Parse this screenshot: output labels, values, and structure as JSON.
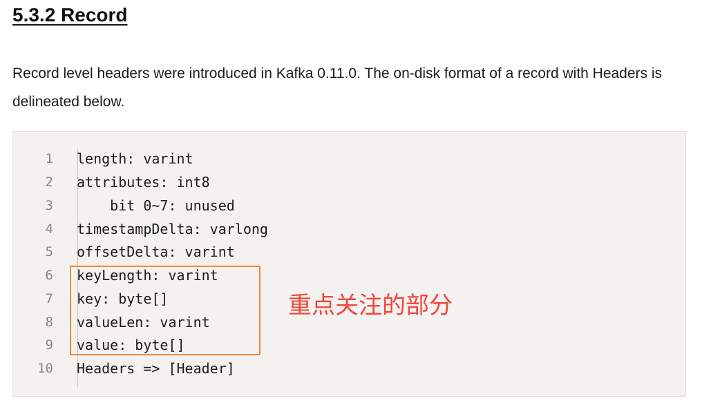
{
  "heading": "5.3.2 Record",
  "intro": "Record level headers were introduced in Kafka 0.11.0. The on-disk format of a record with Headers is delineated below.",
  "code": {
    "lines": [
      {
        "number": "1",
        "text": "length: varint"
      },
      {
        "number": "2",
        "text": "attributes: int8"
      },
      {
        "number": "3",
        "text": "    bit 0~7: unused"
      },
      {
        "number": "4",
        "text": "timestampDelta: varlong"
      },
      {
        "number": "5",
        "text": "offsetDelta: varint"
      },
      {
        "number": "6",
        "text": "keyLength: varint"
      },
      {
        "number": "7",
        "text": "key: byte[]"
      },
      {
        "number": "8",
        "text": "valueLen: varint"
      },
      {
        "number": "9",
        "text": "value: byte[]"
      },
      {
        "number": "10",
        "text": "Headers => [Header]"
      }
    ],
    "highlighted_lines": [
      6,
      7,
      8,
      9
    ]
  },
  "annotation": {
    "text": "重点关注的部分",
    "color": "#f0463c",
    "box_color": "#f0883a"
  }
}
